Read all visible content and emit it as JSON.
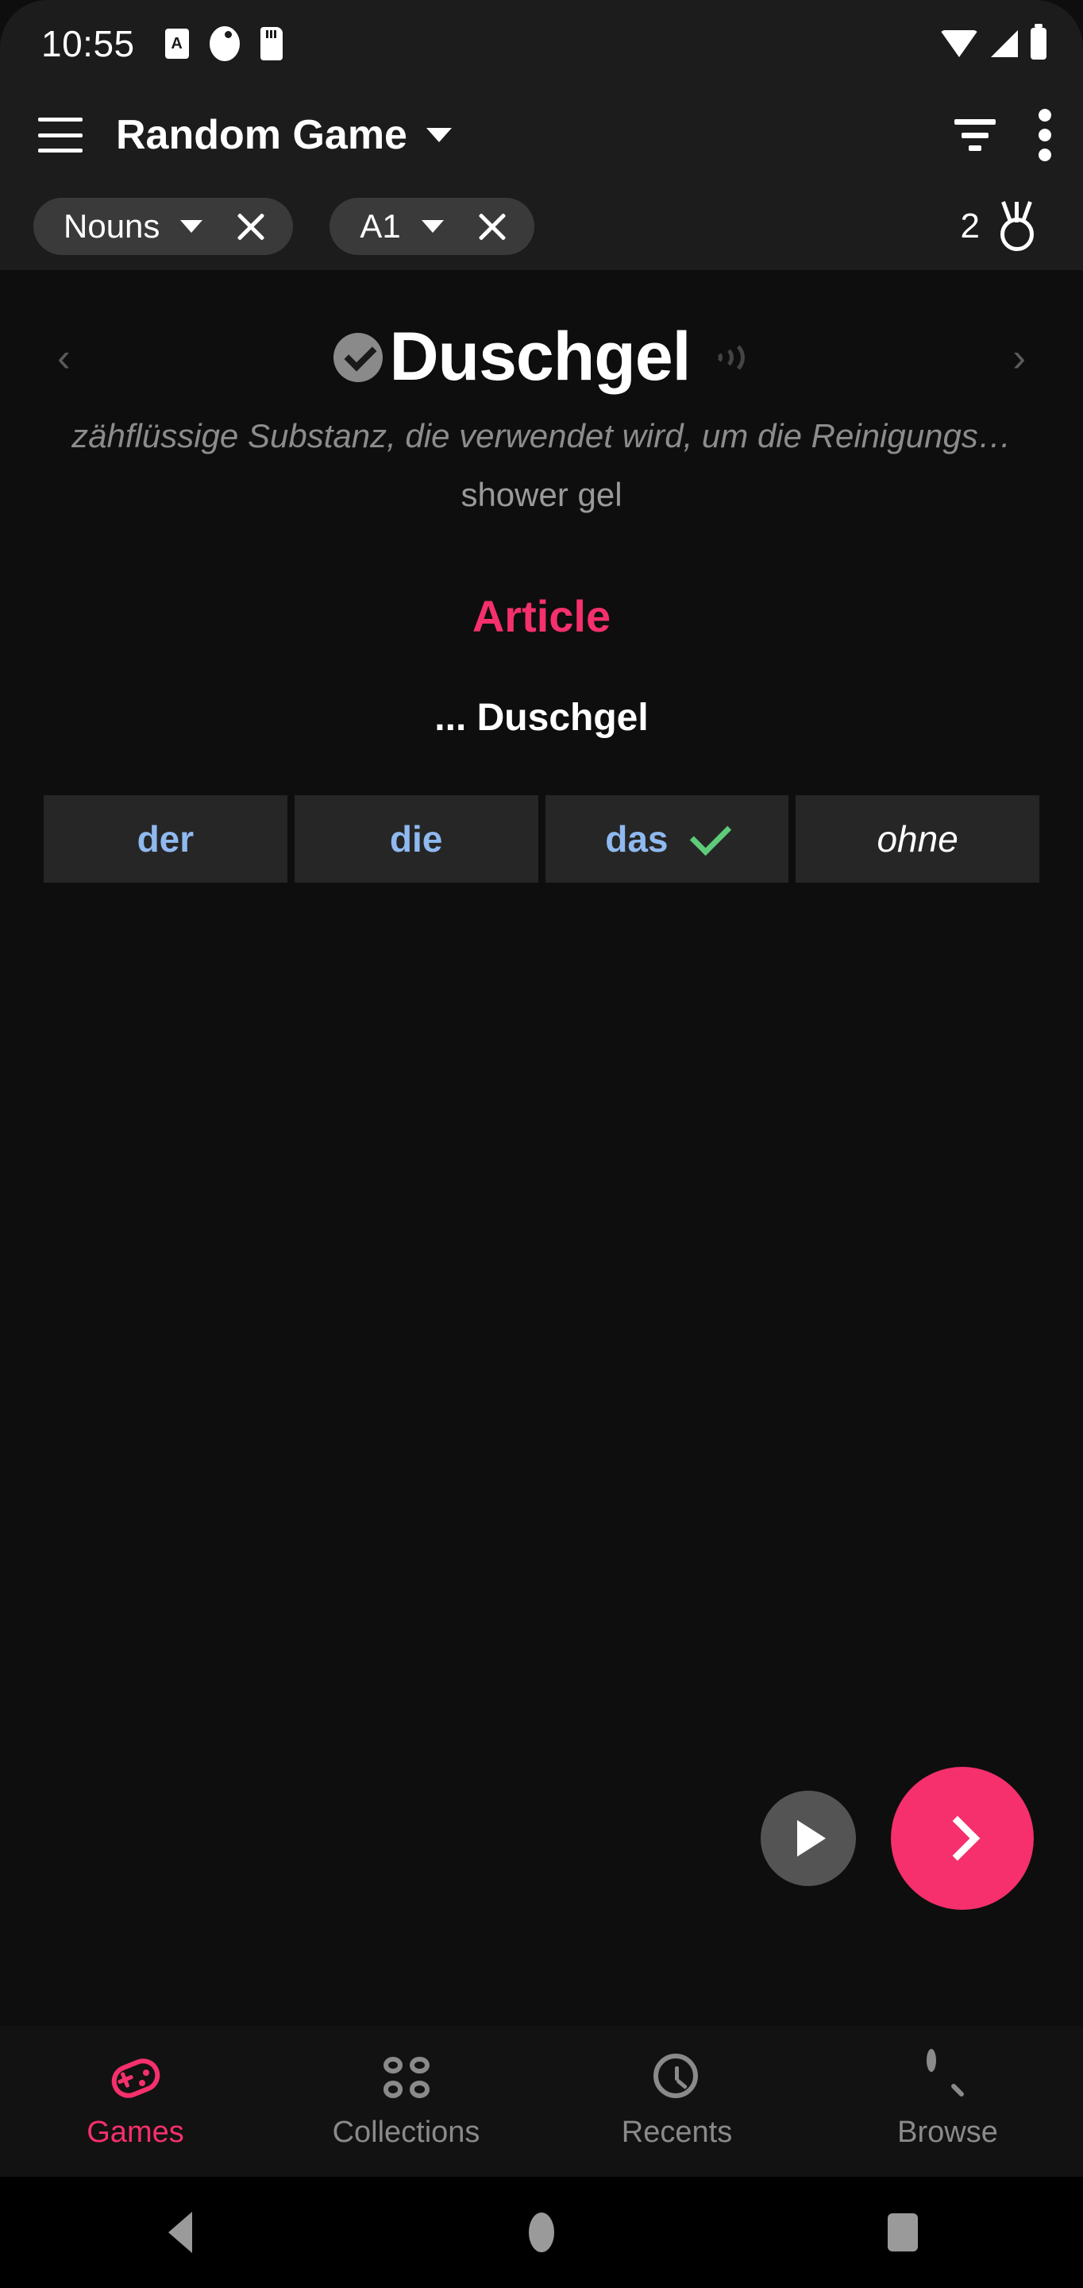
{
  "statusbar": {
    "time": "10:55",
    "icons": [
      "alarm-icon",
      "pie-icon",
      "sd-card-icon"
    ],
    "right_icons": [
      "wifi-icon",
      "signal-icon",
      "battery-icon"
    ],
    "alarm_glyph": "A"
  },
  "appbar": {
    "menu_icon": "hamburger-menu-icon",
    "title": "Random Game",
    "dropdown_icon": "chevron-down-icon",
    "filter_icon": "filter-icon",
    "overflow_icon": "overflow-menu-icon"
  },
  "filters": {
    "chips": [
      {
        "label": "Nouns",
        "dropdown_icon": "chevron-down-icon",
        "remove_icon": "close-icon"
      },
      {
        "label": "A1",
        "dropdown_icon": "chevron-down-icon",
        "remove_icon": "close-icon"
      }
    ],
    "score": "2",
    "score_icon": "medal-icon"
  },
  "card": {
    "prev_arrow": "‹",
    "next_arrow": "›",
    "learned_icon": "check-circle-icon",
    "headword": "Duschgel",
    "speaker_icon": "sound-wave-icon",
    "definition": "zähflüssige Substanz, die verwendet wird, um die Reinigungs…",
    "translation": "shower gel",
    "section_title": "Article",
    "prompt": "... Duschgel"
  },
  "answers": [
    {
      "label": "der",
      "correct": false
    },
    {
      "label": "die",
      "correct": false
    },
    {
      "label": "das",
      "correct": true,
      "tick_icon": "check-icon"
    },
    {
      "label": "ohne",
      "correct": false,
      "style": "skip"
    }
  ],
  "fabs": {
    "play_icon": "play-icon",
    "next_icon": "chevron-right-icon",
    "accent": "#f5306c"
  },
  "bottomnav": {
    "items": [
      {
        "label": "Games",
        "icon": "gamepad-icon",
        "active": true
      },
      {
        "label": "Collections",
        "icon": "grid-four-circles-icon",
        "active": false
      },
      {
        "label": "Recents",
        "icon": "clock-icon",
        "active": false
      },
      {
        "label": "Browse",
        "icon": "search-icon",
        "active": false
      }
    ]
  },
  "sysnav": {
    "back_icon": "back-triangle-icon",
    "home_icon": "home-circle-icon",
    "recents_icon": "recents-square-icon"
  }
}
